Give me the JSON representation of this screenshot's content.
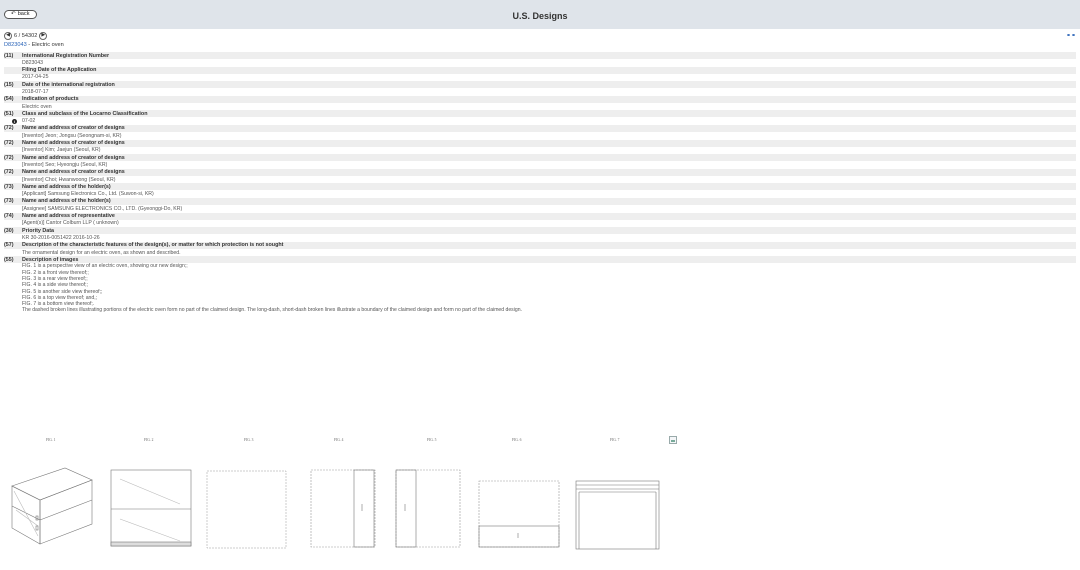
{
  "header": {
    "back_label": "back",
    "title": "U.S. Designs"
  },
  "nav": {
    "position": "6 / 54302",
    "prev_icon": "chevron-left-icon",
    "next_icon": "chevron-right-icon"
  },
  "record": {
    "id": "D823043",
    "title_rest": " - Electric oven",
    "link_icon": "link-icon"
  },
  "sections": [
    {
      "code": "(11)",
      "label": "International Registration Number",
      "value": "D823043"
    },
    {
      "code": "",
      "label": "Filing Date of the Application",
      "value": "2017-04-25"
    },
    {
      "code": "(15)",
      "label": "Date of the international registration",
      "value": "2018-07-17"
    },
    {
      "code": "(54)",
      "label": "Indication of products",
      "value": "Electric oven"
    },
    {
      "code": "(51)",
      "label": "Class and subclass of the Locarno Classification",
      "value": "07-02",
      "bullet": "i"
    },
    {
      "code": "(72)",
      "label": "Name and address of creator of designs",
      "value": "[Inventor] Jeon; Jongsu (Seongnam-si, KR)"
    },
    {
      "code": "(72)",
      "label": "Name and address of creator of designs",
      "value": "[Inventor] Kim; Jaejun (Seoul, KR)"
    },
    {
      "code": "(72)",
      "label": "Name and address of creator of designs",
      "value": "[Inventor] Seo; Hyeongju (Seoul, KR)"
    },
    {
      "code": "(72)",
      "label": "Name and address of creator of designs",
      "value": "[Inventor] Choi; Hwanwoong (Seoul, KR)"
    },
    {
      "code": "(73)",
      "label": "Name and address of the holder(s)",
      "value": "[Applicant] Samsung Electronics Co., Ltd. (Suwon-si, KR)"
    },
    {
      "code": "(73)",
      "label": "Name and address of the holder(s)",
      "value": "[Assignee] SAMSUNG ELECTRONICS CO., LTD. (Gyeonggi-Do, KR)"
    },
    {
      "code": "(74)",
      "label": "Name and address of representative",
      "value": "[Agent(s)] Cantor Colburn LLP ( unknown)"
    },
    {
      "code": "(30)",
      "label": "Priority Data",
      "value": "KR 30-2016-0051422 2016-10-26"
    },
    {
      "code": "(57)",
      "label": "Description of the characteristic features of the design(s), or matter for which protection is not sought",
      "value": "The ornamental design for an electric oven, as shown and described."
    }
  ],
  "images_section": {
    "code": "(55)",
    "label": "Description of images",
    "lines": [
      "FIG. 1 is a perspective view of an electric oven, showing our new design;;",
      "FIG. 2 is a front view thereof;;",
      "FIG. 3 is a rear view thereof;;",
      "FIG. 4 is a side view thereof;;",
      "FIG. 5 is another side view thereof;;",
      "FIG. 6 is a top view thereof; and,;",
      "FIG. 7 is a bottom view thereof;.",
      "The dashed broken lines illustrating portions of the electric oven form no part of the claimed design. The long-dash, short-dash broken lines illustrate a boundary of the claimed design and form no part of the claimed design."
    ]
  },
  "figures": [
    {
      "label": "FIG. 1"
    },
    {
      "label": "FIG. 2"
    },
    {
      "label": "FIG. 3"
    },
    {
      "label": "FIG. 4"
    },
    {
      "label": "FIG. 5"
    },
    {
      "label": "FIG. 6"
    },
    {
      "label": "FIG. 7"
    }
  ],
  "broken_image_icon": "broken-image-icon"
}
